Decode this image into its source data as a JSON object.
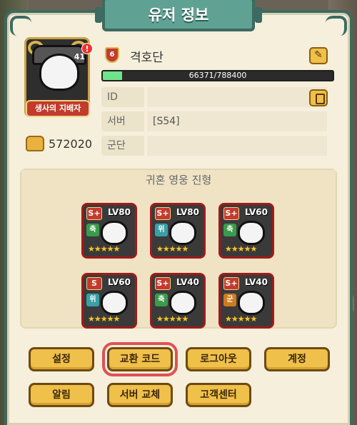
{
  "title": "유저 정보",
  "profile": {
    "avatar_level": "41",
    "alert": "!",
    "nameplate": "생사의 지배자",
    "rank": "6",
    "username": "격호단",
    "exp_text": "66371/788400",
    "exp_fraction": 0.084,
    "power": "572020"
  },
  "fields": {
    "id_label": "ID",
    "id_value": "",
    "server_label": "서버",
    "server_value": "[S54]",
    "guild_label": "군단",
    "guild_value": ""
  },
  "heroes": {
    "title": "귀혼 영웅 진형",
    "list": [
      {
        "grade": "S+",
        "level": "LV80",
        "element": "축",
        "color": "#3a9b4b"
      },
      {
        "grade": "S+",
        "level": "LV80",
        "element": "위",
        "color": "#3aa0a6"
      },
      {
        "grade": "S+",
        "level": "LV60",
        "element": "축",
        "color": "#3a9b4b"
      },
      {
        "grade": "S",
        "level": "LV60",
        "element": "위",
        "color": "#3aa0a6"
      },
      {
        "grade": "S+",
        "level": "LV40",
        "element": "축",
        "color": "#3a9b4b"
      },
      {
        "grade": "S+",
        "level": "LV40",
        "element": "군",
        "color": "#d07a1e"
      }
    ]
  },
  "buttons": {
    "settings": "설정",
    "redeem": "교환 코드",
    "logout": "로그아웃",
    "account": "계정",
    "notice": "알림",
    "change_server": "서버 교체",
    "support": "고객센터"
  },
  "icons": {
    "edit": "pencil-icon",
    "copy": "copy-icon",
    "power": "fist-icon"
  }
}
